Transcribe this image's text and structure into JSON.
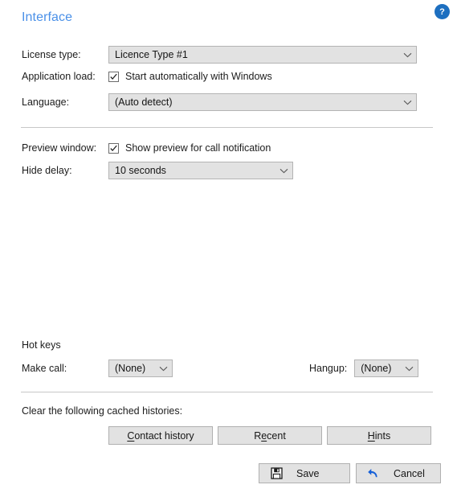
{
  "header": {
    "title": "Interface",
    "help_icon": "question-mark-circle-icon",
    "title_color": "#4a90e8",
    "help_color": "#1d6fc0"
  },
  "interface_section": {
    "license_label": "License type:",
    "license_value": "Licence Type #1",
    "app_load_label": "Application load:",
    "app_load_checkbox_label": "Start automatically with Windows",
    "app_load_checked": true,
    "language_label": "Language:",
    "language_value": "(Auto detect)"
  },
  "preview_section": {
    "preview_label": "Preview window:",
    "preview_checkbox_label": "Show preview for call notification",
    "preview_checked": true,
    "hide_delay_label": "Hide delay:",
    "hide_delay_value": "10 seconds"
  },
  "hotkeys_section": {
    "group_label": "Hot keys",
    "make_call_label": "Make call:",
    "make_call_value": "(None)",
    "hangup_label": "Hangup:",
    "hangup_value": "(None)"
  },
  "cache_section": {
    "title": "Clear the following cached histories:",
    "buttons": [
      {
        "label": "Contact history",
        "accel": "C"
      },
      {
        "label": "Recent",
        "accel": "e"
      },
      {
        "label": "Hints",
        "accel": "H"
      }
    ]
  },
  "footer": {
    "save_label": "Save",
    "save_icon": "floppy-disk-save-icon",
    "cancel_label": "Cancel",
    "cancel_icon": "undo-arrow-icon",
    "cancel_icon_color": "#1660d8"
  }
}
